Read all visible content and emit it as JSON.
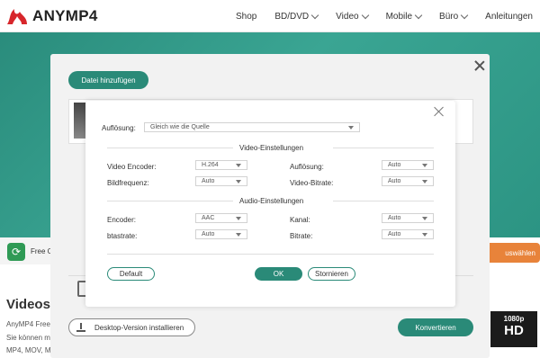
{
  "header": {
    "brand": "ANYMP4",
    "logo_icon": "flame-logo-icon",
    "nav": [
      {
        "label": "Shop",
        "has_dropdown": false
      },
      {
        "label": "BD/DVD",
        "has_dropdown": true
      },
      {
        "label": "Video",
        "has_dropdown": true
      },
      {
        "label": "Mobile",
        "has_dropdown": true
      },
      {
        "label": "Büro",
        "has_dropdown": true
      },
      {
        "label": "Anleitungen",
        "has_dropdown": false
      }
    ]
  },
  "background": {
    "free_label": "Free C",
    "choose_button": "uswählen",
    "section_title": "Videos k",
    "text_line1": "AnyMP4 Free",
    "text_line2": "Sie können me",
    "text_line3": "MP4, MOV, M",
    "badge_top": "1080p",
    "badge_bottom": "HD"
  },
  "panel": {
    "add_file_button": "Datei hinzufügen",
    "install_button": "Desktop-Version installieren",
    "convert_button": "Konvertieren"
  },
  "settings": {
    "resolution_label": "Auflösung:",
    "resolution_value": "Gleich wie die Quelle",
    "video_section": "Video-Einstellungen",
    "audio_section": "Audio-Einstellungen",
    "video_encoder_label": "Video Encoder:",
    "video_encoder_value": "H.264",
    "frame_rate_label": "Bildfrequenz:",
    "frame_rate_value": "Auto",
    "video_resolution_label": "Auflösung:",
    "video_resolution_value": "Auto",
    "video_bitrate_label": "Video-Bitrate:",
    "video_bitrate_value": "Auto",
    "audio_encoder_label": "Encoder:",
    "audio_encoder_value": "AAC",
    "sample_rate_label": "btastrate:",
    "sample_rate_value": "Auto",
    "channel_label": "Kanal:",
    "channel_value": "Auto",
    "bitrate_label": "Bitrate:",
    "bitrate_value": "Auto",
    "default_button": "Default",
    "ok_button": "OK",
    "cancel_button": "Stornieren"
  },
  "colors": {
    "accent": "#2a8a78",
    "hero": "#3aa593",
    "orange": "#e8833a"
  }
}
